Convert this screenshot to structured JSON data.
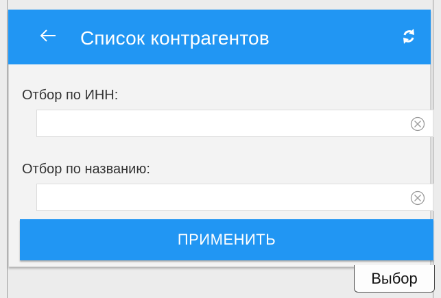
{
  "header": {
    "title": "Список контрагентов",
    "back_icon": "arrow-left-icon",
    "refresh_icon": "refresh-icon",
    "color": "#2196f3"
  },
  "form": {
    "inn_label": "Отбор по ИНН:",
    "inn_value": "",
    "name_label": "Отбор по названию:",
    "name_value": "",
    "clear_icon": "clear-circle-icon"
  },
  "apply_button": {
    "label": "ПРИМЕНИТЬ",
    "color": "#2196f3"
  },
  "tabs": [
    {
      "label": "Выбор",
      "active": true
    }
  ]
}
